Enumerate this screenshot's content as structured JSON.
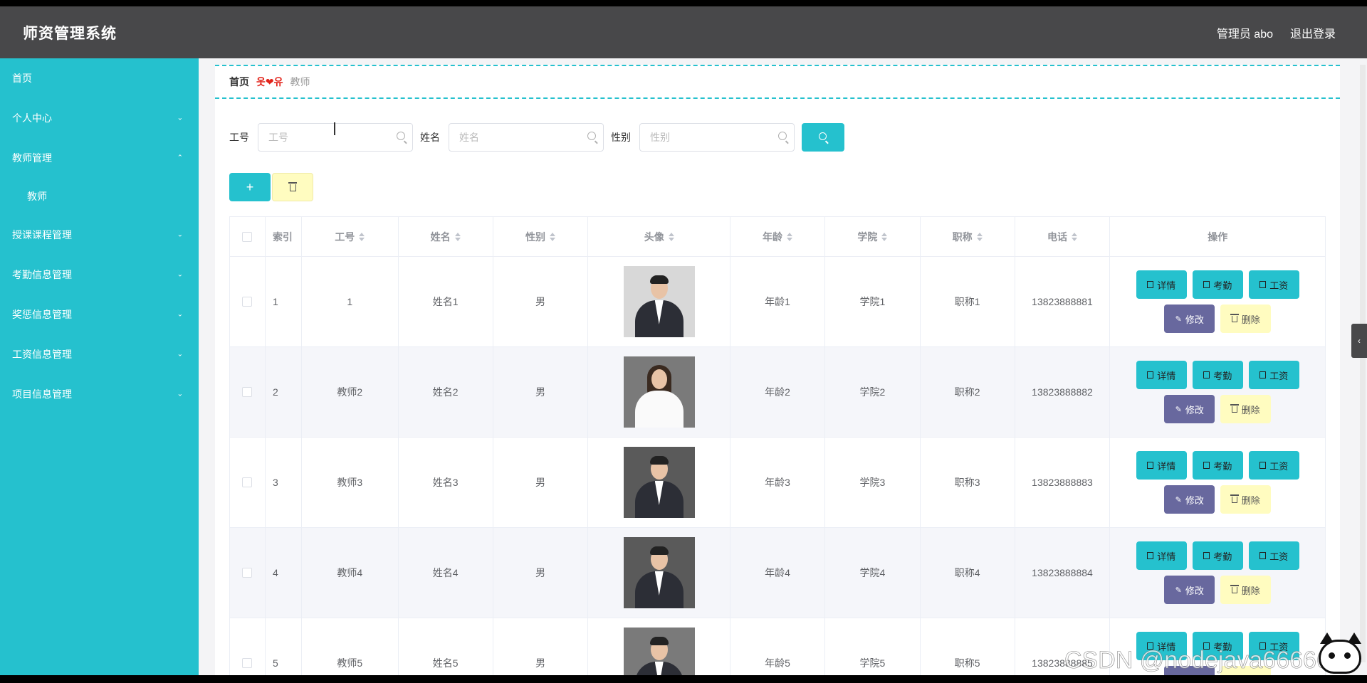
{
  "header": {
    "title": "师资管理系统",
    "user": "管理员 abo",
    "logout": "退出登录"
  },
  "sidebar": {
    "items": [
      {
        "label": "首页",
        "chevron": ""
      },
      {
        "label": "个人中心",
        "chevron": "⌄"
      },
      {
        "label": "教师管理",
        "chevron": "⌃"
      },
      {
        "label": "教师",
        "chevron": "",
        "sub": true
      },
      {
        "label": "授课课程管理",
        "chevron": "⌄"
      },
      {
        "label": "考勤信息管理",
        "chevron": "⌄"
      },
      {
        "label": "奖惩信息管理",
        "chevron": "⌄"
      },
      {
        "label": "工资信息管理",
        "chevron": "⌄"
      },
      {
        "label": "项目信息管理",
        "chevron": "⌄"
      }
    ]
  },
  "breadcrumb": {
    "home": "首页",
    "separator": "옷❤유",
    "current": "教师"
  },
  "search": {
    "gonghao_label": "工号",
    "gonghao_placeholder": "工号",
    "xingming_label": "姓名",
    "xingming_placeholder": "姓名",
    "xingbie_label": "性别",
    "xingbie_placeholder": "性别"
  },
  "actions": {
    "add_label": "+"
  },
  "table": {
    "headers": [
      "索引",
      "工号",
      "姓名",
      "性别",
      "头像",
      "年龄",
      "学院",
      "职称",
      "电话",
      "操作"
    ],
    "rows": [
      {
        "index": "1",
        "gonghao": "1",
        "name": "姓名1",
        "gender": "男",
        "age": "年龄1",
        "college": "学院1",
        "title": "职称1",
        "phone": "13823888881"
      },
      {
        "index": "2",
        "gonghao": "教师2",
        "name": "姓名2",
        "gender": "男",
        "age": "年龄2",
        "college": "学院2",
        "title": "职称2",
        "phone": "13823888882"
      },
      {
        "index": "3",
        "gonghao": "教师3",
        "name": "姓名3",
        "gender": "男",
        "age": "年龄3",
        "college": "学院3",
        "title": "职称3",
        "phone": "13823888883"
      },
      {
        "index": "4",
        "gonghao": "教师4",
        "name": "姓名4",
        "gender": "男",
        "age": "年龄4",
        "college": "学院4",
        "title": "职称4",
        "phone": "13823888884"
      },
      {
        "index": "5",
        "gonghao": "教师5",
        "name": "姓名5",
        "gender": "男",
        "age": "年龄5",
        "college": "学院5",
        "title": "职称5",
        "phone": "13823888885"
      }
    ],
    "ops": {
      "detail": "详情",
      "attendance": "考勤",
      "salary": "工资",
      "edit": "修改",
      "delete": "删除"
    }
  },
  "watermark": "CSDN @nodejava666666",
  "colors": {
    "accent": "#25c1ce",
    "header": "#48484a",
    "edit_button": "#68689e",
    "delete_button": "#fffcc0"
  }
}
